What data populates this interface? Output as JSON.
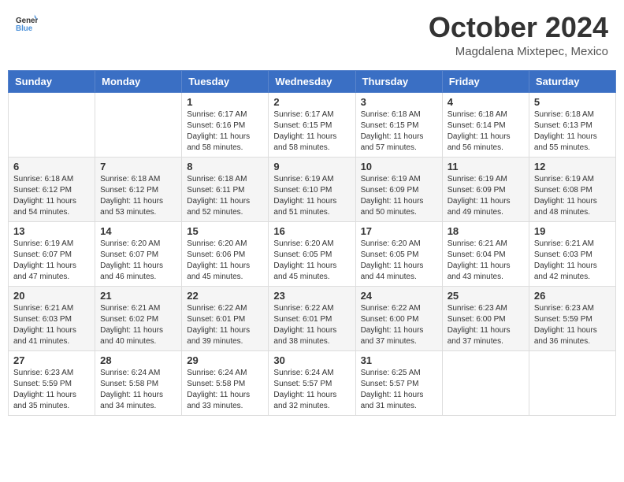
{
  "header": {
    "logo_general": "General",
    "logo_blue": "Blue",
    "month_title": "October 2024",
    "location": "Magdalena Mixtepec, Mexico"
  },
  "days_of_week": [
    "Sunday",
    "Monday",
    "Tuesday",
    "Wednesday",
    "Thursday",
    "Friday",
    "Saturday"
  ],
  "weeks": [
    {
      "days": [
        {
          "num": "",
          "info": ""
        },
        {
          "num": "",
          "info": ""
        },
        {
          "num": "1",
          "info": "Sunrise: 6:17 AM\nSunset: 6:16 PM\nDaylight: 11 hours and 58 minutes."
        },
        {
          "num": "2",
          "info": "Sunrise: 6:17 AM\nSunset: 6:15 PM\nDaylight: 11 hours and 58 minutes."
        },
        {
          "num": "3",
          "info": "Sunrise: 6:18 AM\nSunset: 6:15 PM\nDaylight: 11 hours and 57 minutes."
        },
        {
          "num": "4",
          "info": "Sunrise: 6:18 AM\nSunset: 6:14 PM\nDaylight: 11 hours and 56 minutes."
        },
        {
          "num": "5",
          "info": "Sunrise: 6:18 AM\nSunset: 6:13 PM\nDaylight: 11 hours and 55 minutes."
        }
      ]
    },
    {
      "days": [
        {
          "num": "6",
          "info": "Sunrise: 6:18 AM\nSunset: 6:12 PM\nDaylight: 11 hours and 54 minutes."
        },
        {
          "num": "7",
          "info": "Sunrise: 6:18 AM\nSunset: 6:12 PM\nDaylight: 11 hours and 53 minutes."
        },
        {
          "num": "8",
          "info": "Sunrise: 6:18 AM\nSunset: 6:11 PM\nDaylight: 11 hours and 52 minutes."
        },
        {
          "num": "9",
          "info": "Sunrise: 6:19 AM\nSunset: 6:10 PM\nDaylight: 11 hours and 51 minutes."
        },
        {
          "num": "10",
          "info": "Sunrise: 6:19 AM\nSunset: 6:09 PM\nDaylight: 11 hours and 50 minutes."
        },
        {
          "num": "11",
          "info": "Sunrise: 6:19 AM\nSunset: 6:09 PM\nDaylight: 11 hours and 49 minutes."
        },
        {
          "num": "12",
          "info": "Sunrise: 6:19 AM\nSunset: 6:08 PM\nDaylight: 11 hours and 48 minutes."
        }
      ]
    },
    {
      "days": [
        {
          "num": "13",
          "info": "Sunrise: 6:19 AM\nSunset: 6:07 PM\nDaylight: 11 hours and 47 minutes."
        },
        {
          "num": "14",
          "info": "Sunrise: 6:20 AM\nSunset: 6:07 PM\nDaylight: 11 hours and 46 minutes."
        },
        {
          "num": "15",
          "info": "Sunrise: 6:20 AM\nSunset: 6:06 PM\nDaylight: 11 hours and 45 minutes."
        },
        {
          "num": "16",
          "info": "Sunrise: 6:20 AM\nSunset: 6:05 PM\nDaylight: 11 hours and 45 minutes."
        },
        {
          "num": "17",
          "info": "Sunrise: 6:20 AM\nSunset: 6:05 PM\nDaylight: 11 hours and 44 minutes."
        },
        {
          "num": "18",
          "info": "Sunrise: 6:21 AM\nSunset: 6:04 PM\nDaylight: 11 hours and 43 minutes."
        },
        {
          "num": "19",
          "info": "Sunrise: 6:21 AM\nSunset: 6:03 PM\nDaylight: 11 hours and 42 minutes."
        }
      ]
    },
    {
      "days": [
        {
          "num": "20",
          "info": "Sunrise: 6:21 AM\nSunset: 6:03 PM\nDaylight: 11 hours and 41 minutes."
        },
        {
          "num": "21",
          "info": "Sunrise: 6:21 AM\nSunset: 6:02 PM\nDaylight: 11 hours and 40 minutes."
        },
        {
          "num": "22",
          "info": "Sunrise: 6:22 AM\nSunset: 6:01 PM\nDaylight: 11 hours and 39 minutes."
        },
        {
          "num": "23",
          "info": "Sunrise: 6:22 AM\nSunset: 6:01 PM\nDaylight: 11 hours and 38 minutes."
        },
        {
          "num": "24",
          "info": "Sunrise: 6:22 AM\nSunset: 6:00 PM\nDaylight: 11 hours and 37 minutes."
        },
        {
          "num": "25",
          "info": "Sunrise: 6:23 AM\nSunset: 6:00 PM\nDaylight: 11 hours and 37 minutes."
        },
        {
          "num": "26",
          "info": "Sunrise: 6:23 AM\nSunset: 5:59 PM\nDaylight: 11 hours and 36 minutes."
        }
      ]
    },
    {
      "days": [
        {
          "num": "27",
          "info": "Sunrise: 6:23 AM\nSunset: 5:59 PM\nDaylight: 11 hours and 35 minutes."
        },
        {
          "num": "28",
          "info": "Sunrise: 6:24 AM\nSunset: 5:58 PM\nDaylight: 11 hours and 34 minutes."
        },
        {
          "num": "29",
          "info": "Sunrise: 6:24 AM\nSunset: 5:58 PM\nDaylight: 11 hours and 33 minutes."
        },
        {
          "num": "30",
          "info": "Sunrise: 6:24 AM\nSunset: 5:57 PM\nDaylight: 11 hours and 32 minutes."
        },
        {
          "num": "31",
          "info": "Sunrise: 6:25 AM\nSunset: 5:57 PM\nDaylight: 11 hours and 31 minutes."
        },
        {
          "num": "",
          "info": ""
        },
        {
          "num": "",
          "info": ""
        }
      ]
    }
  ]
}
